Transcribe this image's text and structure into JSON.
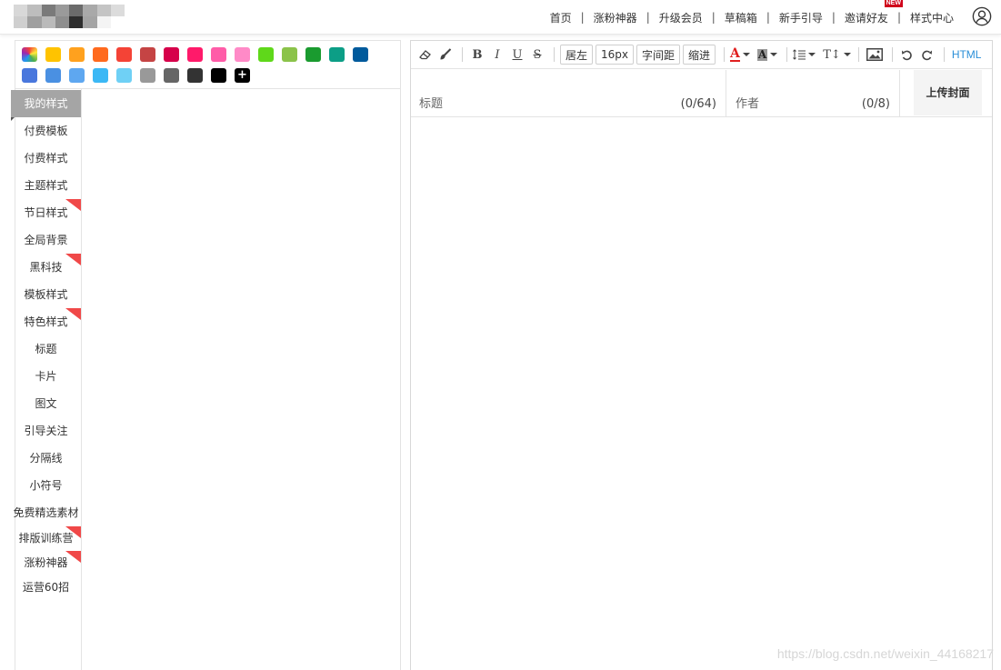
{
  "header": {
    "nav": [
      {
        "label": "首页"
      },
      {
        "label": "涨粉神器"
      },
      {
        "label": "升级会员"
      },
      {
        "label": "草稿箱"
      },
      {
        "label": "新手引导"
      },
      {
        "label": "邀请好友",
        "badge": "NEW"
      },
      {
        "label": "样式中心"
      }
    ],
    "separator": "|"
  },
  "palette": {
    "colors": [
      "#ffc300",
      "#ffa11e",
      "#ff6a1e",
      "#f44336",
      "#c54444",
      "#d6004a",
      "#ff1a6a",
      "#ff5ca8",
      "#ff8ac7",
      "#5fd81a",
      "#8bc34a",
      "#1a9b2f",
      "#0c9e86",
      "#005a9c",
      "#4977dd",
      "#4a90e2",
      "#5ea7f0",
      "#3bb8f5",
      "#6fd0f5",
      "#999999",
      "#666666",
      "#333333",
      "#000000"
    ],
    "plus": "+"
  },
  "sidebar": {
    "tabs": [
      {
        "label": "我的样式",
        "active": true
      },
      {
        "label": "付费模板"
      },
      {
        "label": "付费样式"
      },
      {
        "label": "主题样式"
      },
      {
        "label": "节日样式",
        "flag": true
      },
      {
        "label": "全局背景"
      },
      {
        "label": "黑科技",
        "flag": true
      },
      {
        "label": "模板样式"
      },
      {
        "label": "特色样式",
        "flag": true
      },
      {
        "label": "标题"
      },
      {
        "label": "卡片"
      },
      {
        "label": "图文"
      },
      {
        "label": "引导关注"
      },
      {
        "label": "分隔线"
      },
      {
        "label": "小符号"
      },
      {
        "label": "免费精选素材"
      },
      {
        "label": "排版训练营",
        "flag": true,
        "tall": true
      },
      {
        "label": "涨粉神器",
        "flag": true,
        "tall": true
      },
      {
        "label": "运营60招",
        "tall": true
      }
    ]
  },
  "toolbar": {
    "align_label": "居左",
    "font_size_label": "16px",
    "letter_spacing_label": "字间距",
    "indent_label": "缩进",
    "bold": "B",
    "italic": "I",
    "underline": "U",
    "strike": "S",
    "font_color": "A",
    "bg_color": "A",
    "font_tool": "T↕",
    "html_label": "HTML"
  },
  "editor": {
    "title_placeholder": "标题",
    "title_counter": "(0/64)",
    "author_placeholder": "作者",
    "author_counter": "(0/8)",
    "upload_cover_label": "上传封面"
  },
  "watermark": "https://blog.csdn.net/weixin_44168217"
}
